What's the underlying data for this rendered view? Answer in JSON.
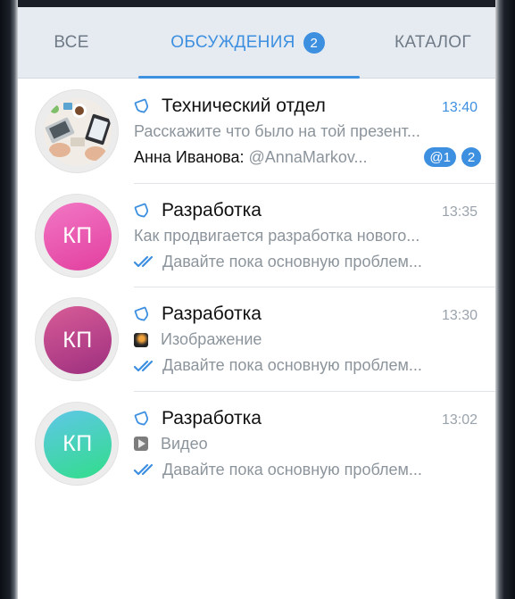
{
  "tabs": {
    "all": {
      "label": "ВСЕ"
    },
    "discussions": {
      "label": "ОБСУЖДЕНИЯ",
      "badge": "2"
    },
    "catalog": {
      "label": "КАТАЛОГ"
    }
  },
  "colors": {
    "accent": "#3d8fe0",
    "tabbar_bg": "#e6ebf1",
    "muted_text": "#8c949c"
  },
  "chats": [
    {
      "title": "Технический отдел",
      "time": "13:40",
      "preview": "Расскажите что было на той презент...",
      "sender": "Анна Иванова:",
      "last_message": "@AnnaMarkov...",
      "mention_badge": "@1",
      "unread_count": "2",
      "avatar": "photo-desk-icon",
      "group_icon": "group-chat-icon"
    },
    {
      "title": "Разработка",
      "time": "13:35",
      "avatar_initials": "КП",
      "preview": "Как продвигается разработка нового...",
      "last_message": "Давайте пока основную проблем...",
      "group_icon": "group-chat-icon",
      "status_icon": "double-check-icon"
    },
    {
      "title": "Разработка",
      "time": "13:30",
      "avatar_initials": "КП",
      "preview": "Изображение",
      "preview_icon": "image-thumbnail-icon",
      "last_message": "Давайте пока основную проблем...",
      "group_icon": "group-chat-icon",
      "status_icon": "double-check-icon"
    },
    {
      "title": "Разработка",
      "time": "13:02",
      "avatar_initials": "КП",
      "preview": "Видео",
      "preview_icon": "video-thumbnail-icon",
      "last_message": "Давайте пока основную проблем...",
      "group_icon": "group-chat-icon",
      "status_icon": "double-check-icon"
    }
  ]
}
